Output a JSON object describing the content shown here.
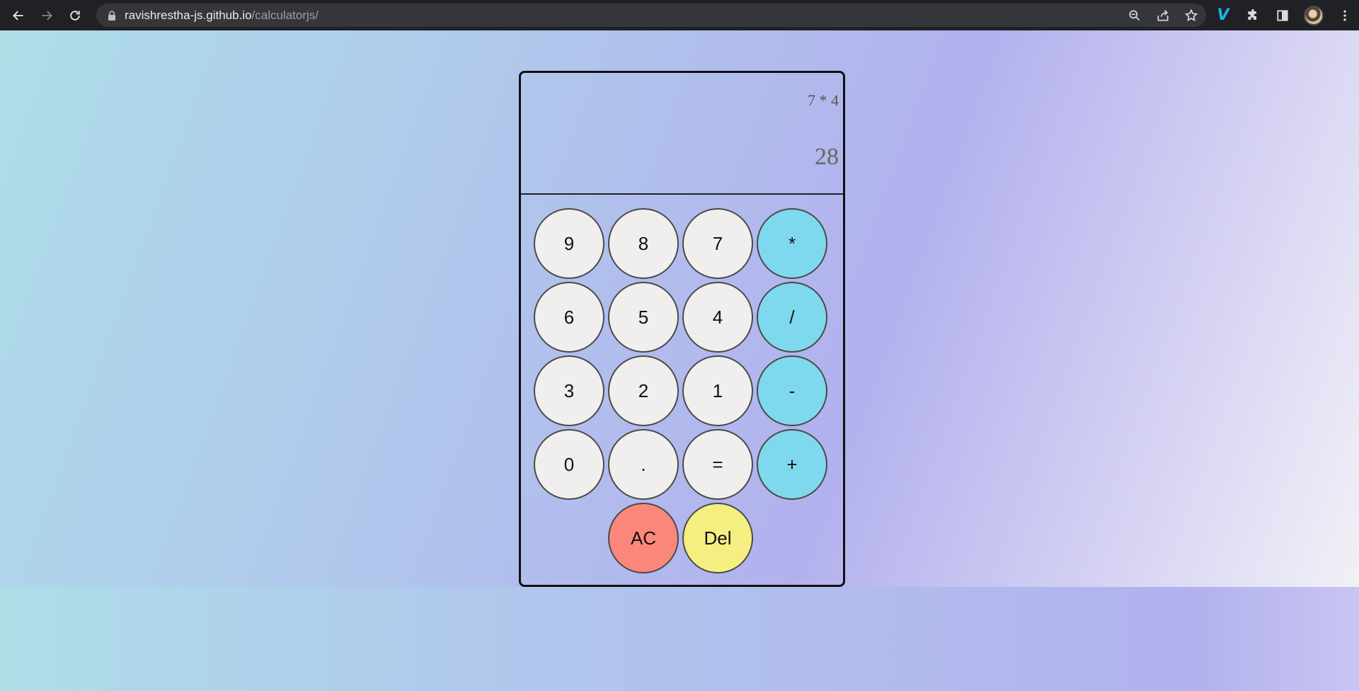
{
  "browser": {
    "url_host": "ravishrestha-js.github.io",
    "url_path": "/calculatorjs/",
    "nav": {
      "back": "back-icon",
      "forward": "forward-icon",
      "reload": "reload-icon"
    },
    "omnibox_icons": [
      "zoom-icon",
      "share-icon",
      "bookmark-star-icon"
    ],
    "extension_icons": [
      "vimeo-icon",
      "extensions-puzzle-icon",
      "side-panel-icon",
      "profile-avatar",
      "menu-kebab-icon"
    ],
    "vimeo_glyph": "V"
  },
  "calculator": {
    "previous_operand": "7 * 4",
    "current_operand": "28",
    "keys": {
      "k9": "9",
      "k8": "8",
      "k7": "7",
      "mul": "*",
      "k6": "6",
      "k5": "5",
      "k4": "4",
      "div": "/",
      "k3": "3",
      "k2": "2",
      "k1": "1",
      "sub": "-",
      "k0": "0",
      "dot": ".",
      "eq": "=",
      "add": "+",
      "ac": "AC",
      "del": "Del"
    },
    "colors": {
      "digit": "#f0efee",
      "operator": "#7fd9ee",
      "clear": "#fb877b",
      "delete": "#f4ef80"
    }
  }
}
